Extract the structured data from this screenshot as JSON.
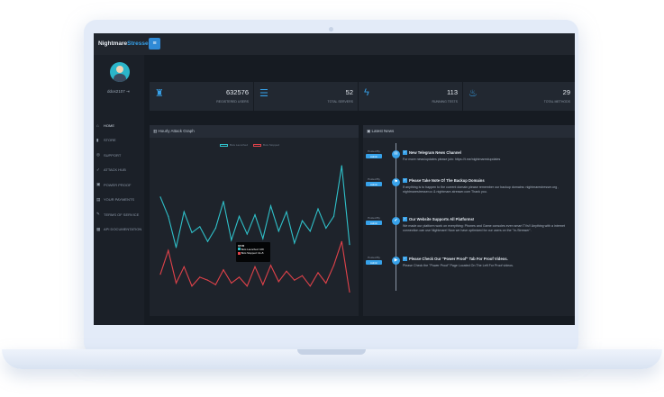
{
  "brand": {
    "name_part1": "Nightmare",
    "name_part2": "Stresser"
  },
  "user": {
    "name": "ddos2107"
  },
  "nav": [
    {
      "label": "HOME",
      "icon": "home-icon",
      "glyph": "⌂"
    },
    {
      "label": "STORE",
      "icon": "cart-icon",
      "glyph": "▮"
    },
    {
      "label": "SUPPORT",
      "icon": "support-icon",
      "glyph": "◎"
    },
    {
      "label": "ATTACK HUB",
      "icon": "bolt-icon",
      "glyph": "✓"
    },
    {
      "label": "POWER PROOF",
      "icon": "video-icon",
      "glyph": "▣"
    },
    {
      "label": "YOUR PAYMENTS",
      "icon": "card-icon",
      "glyph": "▤"
    },
    {
      "label": "TERMS OF SERVICE",
      "icon": "document-icon",
      "glyph": "✎"
    },
    {
      "label": "API DOCUMENTATION",
      "icon": "code-icon",
      "glyph": "▩"
    }
  ],
  "stats": [
    {
      "value": "632576",
      "label": "REGISTERED USERS",
      "icon": "users-icon",
      "glyph": "♜"
    },
    {
      "value": "52",
      "label": "TOTAL SERVERS",
      "icon": "server-icon",
      "glyph": "☰"
    },
    {
      "value": "113",
      "label": "RUNNING TESTS",
      "icon": "lightning-icon",
      "glyph": "ϟ"
    },
    {
      "value": "29",
      "label": "TOTAL METHODS",
      "icon": "flame-icon",
      "glyph": "♨"
    }
  ],
  "graph_panel": {
    "title": "Hourly Attack Graph",
    "icon": "chart-icon"
  },
  "news_panel": {
    "title": "Latest News",
    "icon": "news-icon"
  },
  "chart_data": {
    "type": "line",
    "legend_placement": "top",
    "series": [
      {
        "name": "Bots Launched",
        "color": "#2fc0c9",
        "values": [
          68,
          55,
          34,
          58,
          44,
          48,
          38,
          47,
          65,
          39,
          55,
          43,
          56,
          40,
          62,
          45,
          58,
          37,
          52,
          45,
          60,
          47,
          55,
          89,
          36
        ]
      },
      {
        "name": "Bots Stopped",
        "color": "#e0424a",
        "values": [
          16,
          32,
          10,
          21,
          8,
          14,
          12,
          9,
          19,
          10,
          14,
          8,
          21,
          9,
          22,
          11,
          18,
          12,
          15,
          8,
          17,
          10,
          22,
          38,
          4
        ]
      }
    ],
    "ylim": [
      0,
      100
    ],
    "grid": false
  },
  "tooltip": {
    "title": "18:00",
    "line1": "Bots Launched: 168",
    "line2": "Bots Stopped: 12+5"
  },
  "news": [
    {
      "posted": "Posted By",
      "tag": "Admin",
      "glyph": "✉",
      "title": "New Telegram News Channel",
      "text": "For more news/updates please join: https://t.me/nightmarestupdates"
    },
    {
      "posted": "Posted By",
      "tag": "Admin",
      "glyph": "⚑",
      "title": "Please Take Note Of The Backup Domains",
      "text": "If anything is to happen to the current domain please remember our backup domains: nightmarestresser.org , nightmarestresser.cc & nightmare-stresser.com Thank you."
    },
    {
      "posted": "Posted By",
      "tag": "Admin",
      "glyph": "✔",
      "title": "Our Website Supports All Platforms!",
      "text": "We made our platform work on everything: Phones and Game consoles even smart TVs!! Anything with a internet connection can use Nightmare! Now we have optimized for our users on the \"In-Stresser\"."
    },
    {
      "posted": "Posted By",
      "tag": "Admin",
      "glyph": "▶",
      "title": "Please Check Our \"Power Proof\" Tab For Proof Videos.",
      "text": "Please Check the \"Power Proof\" Page Located On The Left For Proof videos."
    }
  ]
}
